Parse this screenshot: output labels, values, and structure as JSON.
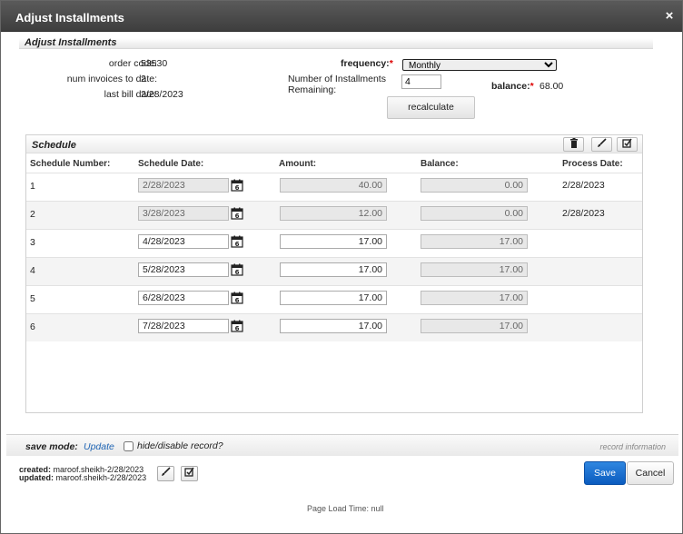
{
  "window": {
    "title": "Adjust Installments",
    "close_glyph": "×"
  },
  "section": {
    "title": "Adjust Installments"
  },
  "info": {
    "order_code_label": "order code:",
    "order_code": "53530",
    "num_invoices_label": "num invoices to date:",
    "num_invoices": "2",
    "last_bill_label": "last bill date:",
    "last_bill": "2/28/2023"
  },
  "frequency": {
    "label": "frequency:",
    "required": "*",
    "value": "Monthly",
    "options": [
      "Monthly"
    ]
  },
  "installments": {
    "label_line1": "Number of Installments",
    "label_line2": "Remaining:",
    "value": "4"
  },
  "balance": {
    "label": "balance:",
    "required": "*",
    "value": "68.00"
  },
  "recalculate_label": "recalculate",
  "schedule": {
    "title": "Schedule",
    "toolbar_icons": [
      "trash-icon",
      "brush-icon",
      "edit-check-icon"
    ],
    "columns": [
      "Schedule Number:",
      "Schedule Date:",
      "Amount:",
      "Balance:",
      "Process Date:"
    ],
    "rows": [
      {
        "num": "1",
        "date": "2/28/2023",
        "amount": "40.00",
        "balance": "0.00",
        "process": "2/28/2023",
        "readonly": true
      },
      {
        "num": "2",
        "date": "3/28/2023",
        "amount": "12.00",
        "balance": "0.00",
        "process": "2/28/2023",
        "readonly": true
      },
      {
        "num": "3",
        "date": "4/28/2023",
        "amount": "17.00",
        "balance": "17.00",
        "process": "",
        "readonly": false
      },
      {
        "num": "4",
        "date": "5/28/2023",
        "amount": "17.00",
        "balance": "17.00",
        "process": "",
        "readonly": false
      },
      {
        "num": "5",
        "date": "6/28/2023",
        "amount": "17.00",
        "balance": "17.00",
        "process": "",
        "readonly": false
      },
      {
        "num": "6",
        "date": "7/28/2023",
        "amount": "17.00",
        "balance": "17.00",
        "process": "",
        "readonly": false
      }
    ]
  },
  "footer": {
    "save_mode_label": "save mode:",
    "save_mode_value": "Update",
    "hide_label": "hide/disable record?",
    "record_info": "record information",
    "created_label": "created:",
    "created_value": "maroof.sheikh-2/28/2023",
    "updated_label": "updated:",
    "updated_value": "maroof.sheikh-2/28/2023",
    "save_label": "Save",
    "cancel_label": "Cancel",
    "page_load": "Page Load Time: null"
  },
  "colors": {
    "titlebar": "#4a4a4a",
    "save_button": "#1a6fd0",
    "link": "#1e64b4",
    "required": "#dd0000"
  }
}
